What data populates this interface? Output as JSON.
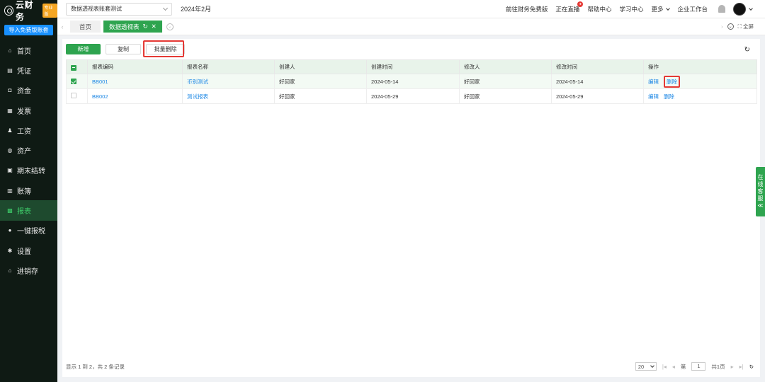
{
  "sidebar": {
    "logo_text": "云财务",
    "logo_badge": "专业版",
    "import_button": "导入免费版账套",
    "items": [
      {
        "label": "首页",
        "icon": "home-icon",
        "glyph": "⌂"
      },
      {
        "label": "凭证",
        "icon": "voucher-icon",
        "glyph": "▤"
      },
      {
        "label": "资金",
        "icon": "fund-icon",
        "glyph": "◘"
      },
      {
        "label": "发票",
        "icon": "invoice-icon",
        "glyph": "▦"
      },
      {
        "label": "工资",
        "icon": "salary-icon",
        "glyph": "♟"
      },
      {
        "label": "资产",
        "icon": "asset-icon",
        "glyph": "◍"
      },
      {
        "label": "期末结转",
        "icon": "closing-icon",
        "glyph": "▣"
      },
      {
        "label": "账簿",
        "icon": "ledger-icon",
        "glyph": "▥"
      },
      {
        "label": "报表",
        "icon": "report-icon",
        "glyph": "▩",
        "active": true
      },
      {
        "label": "一键报税",
        "icon": "tax-icon",
        "glyph": "●"
      },
      {
        "label": "设置",
        "icon": "settings-icon",
        "glyph": "✱"
      },
      {
        "label": "进销存",
        "icon": "inventory-icon",
        "glyph": "⌂"
      }
    ]
  },
  "topbar": {
    "book_select": "数据透视表账套测试",
    "period": "2024年2月",
    "links": {
      "free_version": "前往财务免费版",
      "live": "正在直播",
      "help": "帮助中心",
      "learn": "学习中心",
      "more": "更多",
      "workspace": "企业工作台"
    }
  },
  "tabs": {
    "home": "首页",
    "active": "数据透视表",
    "fullscreen": "全屏"
  },
  "toolbar": {
    "add": "新增",
    "copy": "复制",
    "batch_delete": "批量删除"
  },
  "table": {
    "headers": [
      "报表编码",
      "报表名称",
      "创建人",
      "创建时间",
      "修改人",
      "修改时间",
      "操作"
    ],
    "rows": [
      {
        "code": "BB001",
        "name": "币别测试",
        "creator": "好回家",
        "created": "2024-05-14",
        "modifier": "好回家",
        "modified": "2024-05-14",
        "checked": true
      },
      {
        "code": "BB002",
        "name": "测试报表",
        "creator": "好回家",
        "created": "2024-05-29",
        "modifier": "好回家",
        "modified": "2024-05-29",
        "checked": false
      }
    ],
    "edit_label": "编辑",
    "delete_label": "删除"
  },
  "footer": {
    "summary": "显示 1 到 2，共 2 条记录",
    "page_size": "20",
    "page_prefix": "第",
    "page_value": "1",
    "page_total": "共1页"
  },
  "float_service": [
    "在",
    "线",
    "客",
    "服",
    "≪"
  ],
  "colors": {
    "sidebar_bg": "#0f1a14",
    "accent_green": "#2ea44f",
    "link_blue": "#1e88e5",
    "highlight_red": "#e53935"
  }
}
